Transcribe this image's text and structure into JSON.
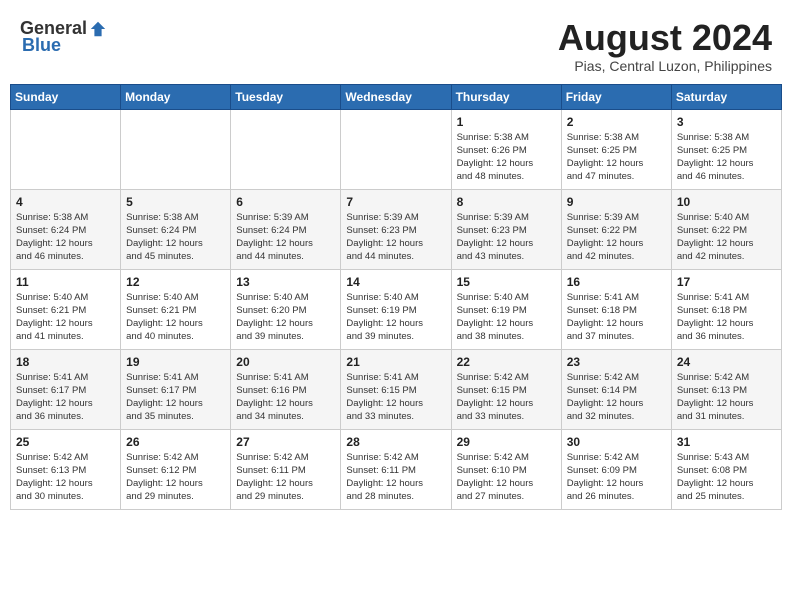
{
  "logo": {
    "general": "General",
    "blue": "Blue"
  },
  "header": {
    "month": "August 2024",
    "location": "Pias, Central Luzon, Philippines"
  },
  "weekdays": [
    "Sunday",
    "Monday",
    "Tuesday",
    "Wednesday",
    "Thursday",
    "Friday",
    "Saturday"
  ],
  "weeks": [
    [
      {
        "day": "",
        "content": ""
      },
      {
        "day": "",
        "content": ""
      },
      {
        "day": "",
        "content": ""
      },
      {
        "day": "",
        "content": ""
      },
      {
        "day": "1",
        "content": "Sunrise: 5:38 AM\nSunset: 6:26 PM\nDaylight: 12 hours\nand 48 minutes."
      },
      {
        "day": "2",
        "content": "Sunrise: 5:38 AM\nSunset: 6:25 PM\nDaylight: 12 hours\nand 47 minutes."
      },
      {
        "day": "3",
        "content": "Sunrise: 5:38 AM\nSunset: 6:25 PM\nDaylight: 12 hours\nand 46 minutes."
      }
    ],
    [
      {
        "day": "4",
        "content": "Sunrise: 5:38 AM\nSunset: 6:24 PM\nDaylight: 12 hours\nand 46 minutes."
      },
      {
        "day": "5",
        "content": "Sunrise: 5:38 AM\nSunset: 6:24 PM\nDaylight: 12 hours\nand 45 minutes."
      },
      {
        "day": "6",
        "content": "Sunrise: 5:39 AM\nSunset: 6:24 PM\nDaylight: 12 hours\nand 44 minutes."
      },
      {
        "day": "7",
        "content": "Sunrise: 5:39 AM\nSunset: 6:23 PM\nDaylight: 12 hours\nand 44 minutes."
      },
      {
        "day": "8",
        "content": "Sunrise: 5:39 AM\nSunset: 6:23 PM\nDaylight: 12 hours\nand 43 minutes."
      },
      {
        "day": "9",
        "content": "Sunrise: 5:39 AM\nSunset: 6:22 PM\nDaylight: 12 hours\nand 42 minutes."
      },
      {
        "day": "10",
        "content": "Sunrise: 5:40 AM\nSunset: 6:22 PM\nDaylight: 12 hours\nand 42 minutes."
      }
    ],
    [
      {
        "day": "11",
        "content": "Sunrise: 5:40 AM\nSunset: 6:21 PM\nDaylight: 12 hours\nand 41 minutes."
      },
      {
        "day": "12",
        "content": "Sunrise: 5:40 AM\nSunset: 6:21 PM\nDaylight: 12 hours\nand 40 minutes."
      },
      {
        "day": "13",
        "content": "Sunrise: 5:40 AM\nSunset: 6:20 PM\nDaylight: 12 hours\nand 39 minutes."
      },
      {
        "day": "14",
        "content": "Sunrise: 5:40 AM\nSunset: 6:19 PM\nDaylight: 12 hours\nand 39 minutes."
      },
      {
        "day": "15",
        "content": "Sunrise: 5:40 AM\nSunset: 6:19 PM\nDaylight: 12 hours\nand 38 minutes."
      },
      {
        "day": "16",
        "content": "Sunrise: 5:41 AM\nSunset: 6:18 PM\nDaylight: 12 hours\nand 37 minutes."
      },
      {
        "day": "17",
        "content": "Sunrise: 5:41 AM\nSunset: 6:18 PM\nDaylight: 12 hours\nand 36 minutes."
      }
    ],
    [
      {
        "day": "18",
        "content": "Sunrise: 5:41 AM\nSunset: 6:17 PM\nDaylight: 12 hours\nand 36 minutes."
      },
      {
        "day": "19",
        "content": "Sunrise: 5:41 AM\nSunset: 6:17 PM\nDaylight: 12 hours\nand 35 minutes."
      },
      {
        "day": "20",
        "content": "Sunrise: 5:41 AM\nSunset: 6:16 PM\nDaylight: 12 hours\nand 34 minutes."
      },
      {
        "day": "21",
        "content": "Sunrise: 5:41 AM\nSunset: 6:15 PM\nDaylight: 12 hours\nand 33 minutes."
      },
      {
        "day": "22",
        "content": "Sunrise: 5:42 AM\nSunset: 6:15 PM\nDaylight: 12 hours\nand 33 minutes."
      },
      {
        "day": "23",
        "content": "Sunrise: 5:42 AM\nSunset: 6:14 PM\nDaylight: 12 hours\nand 32 minutes."
      },
      {
        "day": "24",
        "content": "Sunrise: 5:42 AM\nSunset: 6:13 PM\nDaylight: 12 hours\nand 31 minutes."
      }
    ],
    [
      {
        "day": "25",
        "content": "Sunrise: 5:42 AM\nSunset: 6:13 PM\nDaylight: 12 hours\nand 30 minutes."
      },
      {
        "day": "26",
        "content": "Sunrise: 5:42 AM\nSunset: 6:12 PM\nDaylight: 12 hours\nand 29 minutes."
      },
      {
        "day": "27",
        "content": "Sunrise: 5:42 AM\nSunset: 6:11 PM\nDaylight: 12 hours\nand 29 minutes."
      },
      {
        "day": "28",
        "content": "Sunrise: 5:42 AM\nSunset: 6:11 PM\nDaylight: 12 hours\nand 28 minutes."
      },
      {
        "day": "29",
        "content": "Sunrise: 5:42 AM\nSunset: 6:10 PM\nDaylight: 12 hours\nand 27 minutes."
      },
      {
        "day": "30",
        "content": "Sunrise: 5:42 AM\nSunset: 6:09 PM\nDaylight: 12 hours\nand 26 minutes."
      },
      {
        "day": "31",
        "content": "Sunrise: 5:43 AM\nSunset: 6:08 PM\nDaylight: 12 hours\nand 25 minutes."
      }
    ]
  ]
}
